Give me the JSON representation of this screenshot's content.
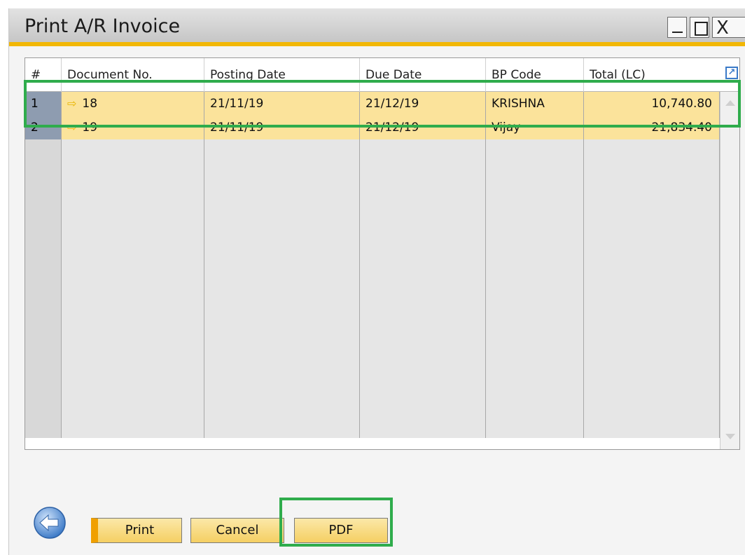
{
  "window": {
    "title": "Print A/R Invoice",
    "close_glyph": "X"
  },
  "grid": {
    "columns": [
      "#",
      "Document No.",
      "Posting Date",
      "Due Date",
      "BP Code",
      "Total (LC)"
    ],
    "rows": [
      {
        "num": "1",
        "doc_no": "18",
        "posting_date": "21/11/19",
        "due_date": "21/12/19",
        "bp_code": "KRISHNA",
        "total": "10,740.80"
      },
      {
        "num": "2",
        "doc_no": "19",
        "posting_date": "21/11/19",
        "due_date": "21/12/19",
        "bp_code": "Vijay",
        "total": "21,834.40"
      }
    ],
    "empty_row_count": 13
  },
  "buttons": {
    "print": "Print",
    "cancel": "Cancel",
    "pdf": "PDF"
  },
  "icons": {
    "row_arrow": "arrow-right-icon",
    "expand": "expand-icon",
    "back": "back-arrow-icon"
  },
  "colors": {
    "accent": "#f2b705",
    "highlight": "#2fac4c",
    "row_selected": "#fbe39b"
  }
}
